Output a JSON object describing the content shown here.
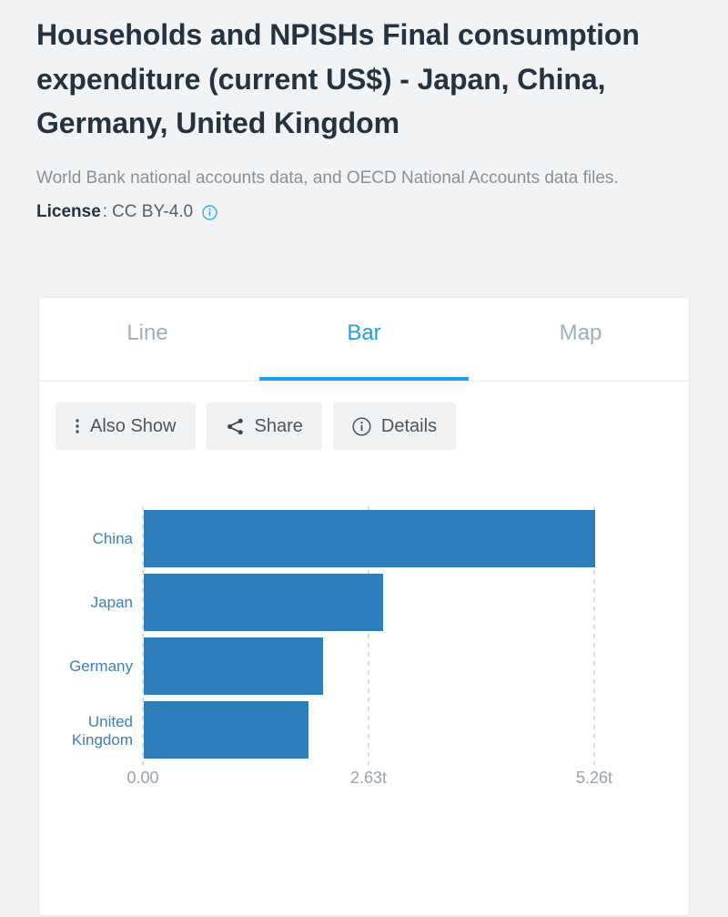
{
  "header": {
    "title": "Households and NPISHs Final consumption expenditure (current US$) - Japan, China, Germany, United Kingdom",
    "source_note": "World Bank national accounts data, and OECD National Accounts data files.",
    "license_label": "License",
    "license_separator": ":",
    "license_value": "CC BY-4.0",
    "info_icon": "info-circle-icon"
  },
  "card": {
    "tabs": [
      {
        "label": "Line",
        "active": false,
        "name": "tab-line"
      },
      {
        "label": "Bar",
        "active": true,
        "name": "tab-bar"
      },
      {
        "label": "Map",
        "active": false,
        "name": "tab-map"
      }
    ],
    "toolbar": [
      {
        "label": "Also Show",
        "icon": "vertical-dots-icon",
        "name": "also-show-button"
      },
      {
        "label": "Share",
        "icon": "share-nodes-icon",
        "name": "share-button"
      },
      {
        "label": "Details",
        "icon": "info-circle-icon",
        "name": "details-button"
      }
    ]
  },
  "colors": {
    "bar": "#2e7ebb",
    "accent": "#1f9cf0",
    "category_label": "#3d7fb5",
    "tick_label": "#9aa3aa",
    "gridline": "#c9ced2",
    "page_background": "#f1f3f4",
    "card_background": "#ffffff",
    "title_text": "#243342",
    "muted_text": "#8a9196"
  },
  "chart_data": {
    "type": "bar",
    "orientation": "horizontal",
    "title": "",
    "xlabel": "",
    "ylabel": "",
    "categories": [
      "China",
      "Japan",
      "Germany",
      "United Kingdom"
    ],
    "values": [
      5.26,
      2.79,
      2.11,
      1.93
    ],
    "value_unit": "trillion current US$",
    "xticks": [
      0,
      2.63,
      5.26
    ],
    "xtick_labels": [
      "0.00",
      "2.63t",
      "5.26t"
    ],
    "xlim": [
      0,
      5.26
    ],
    "grid": true,
    "grid_style": "dashed-vertical",
    "legend": false,
    "series": [
      {
        "name": "Households and NPISHs Final consumption expenditure (current US$)",
        "values": [
          5.26,
          2.79,
          2.11,
          1.93
        ]
      }
    ]
  }
}
